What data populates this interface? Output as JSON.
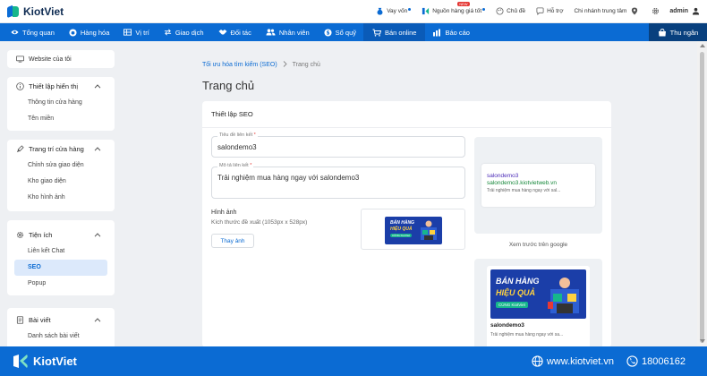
{
  "app": {
    "logo_text": "KiotViet"
  },
  "topbar": {
    "loan": "Vay vốn",
    "supply": "Nguồn hàng giá tốt",
    "supply_tag": "NEW",
    "theme": "Chủ đề",
    "support": "Hỗ trợ",
    "branch": "Chi nhánh trung tâm",
    "user": "admin"
  },
  "nav": {
    "items": [
      {
        "label": "Tổng quan",
        "icon": "eye-icon"
      },
      {
        "label": "Hàng hóa",
        "icon": "box-icon"
      },
      {
        "label": "Vị trí",
        "icon": "grid-icon"
      },
      {
        "label": "Giao dịch",
        "icon": "swap-icon"
      },
      {
        "label": "Đối tác",
        "icon": "handshake-icon"
      },
      {
        "label": "Nhân viên",
        "icon": "users-icon"
      },
      {
        "label": "Sổ quỹ",
        "icon": "coin-icon"
      },
      {
        "label": "Bán online",
        "icon": "cart-icon"
      },
      {
        "label": "Báo cáo",
        "icon": "chart-icon"
      }
    ],
    "active": "Bán online",
    "sale_button": "Thu ngân"
  },
  "sidebar": {
    "website_link": "Website của tôi",
    "sections": [
      {
        "title": "Thiết lập hiển thị",
        "items": [
          "Thông tin cửa hàng",
          "Tên miền"
        ]
      },
      {
        "title": "Trang trí cửa hàng",
        "items": [
          "Chỉnh sửa giao diện",
          "Kho giao diện",
          "Kho hình ảnh"
        ]
      },
      {
        "title": "Tiện ích",
        "items": [
          "Liên kết Chat",
          "SEO",
          "Popup"
        ]
      },
      {
        "title": "Bài viết",
        "items": [
          "Danh sách bài viết"
        ]
      }
    ],
    "active_item": "SEO"
  },
  "main": {
    "breadcrumb": {
      "parent": "Tối ưu hóa tìm kiếm (SEO)",
      "current": "Trang chủ"
    },
    "page_title": "Trang chủ",
    "seo_card": {
      "title": "Thiết lập SEO",
      "link_title_label": "Tiêu đề liên kết",
      "link_title_value": "salondemo3",
      "link_desc_label": "Mô tả liên kết",
      "link_desc_value": "Trải nghiệm mua hàng ngay với salondemo3",
      "image_label": "Hình ảnh",
      "image_hint": "Kích thước đề xuất (1053px x 528px)",
      "change_image_button": "Thay ảnh",
      "google_preview": {
        "title": "salondemo3",
        "url": "salondemo3.kiotvietweb.vn",
        "desc": "Trải nghiệm mua hàng ngay với sal...",
        "caption": "Xem trước trên google"
      },
      "social_preview": {
        "title": "salondemo3",
        "desc": "Trải nghiệm mua hàng ngay với sa..."
      },
      "banner": {
        "line1": "BÁN HÀNG",
        "line2": "HIỆU QUẢ",
        "line3": "CÙNG KiotViet"
      }
    }
  },
  "footer": {
    "logo_text": "KiotViet",
    "website": "www.kiotviet.vn",
    "hotline": "18006162"
  },
  "colors": {
    "primary": "#0b6bd3",
    "nav_dark": "#08407e",
    "accent_green": "#16b68c",
    "required": "#e53935"
  }
}
